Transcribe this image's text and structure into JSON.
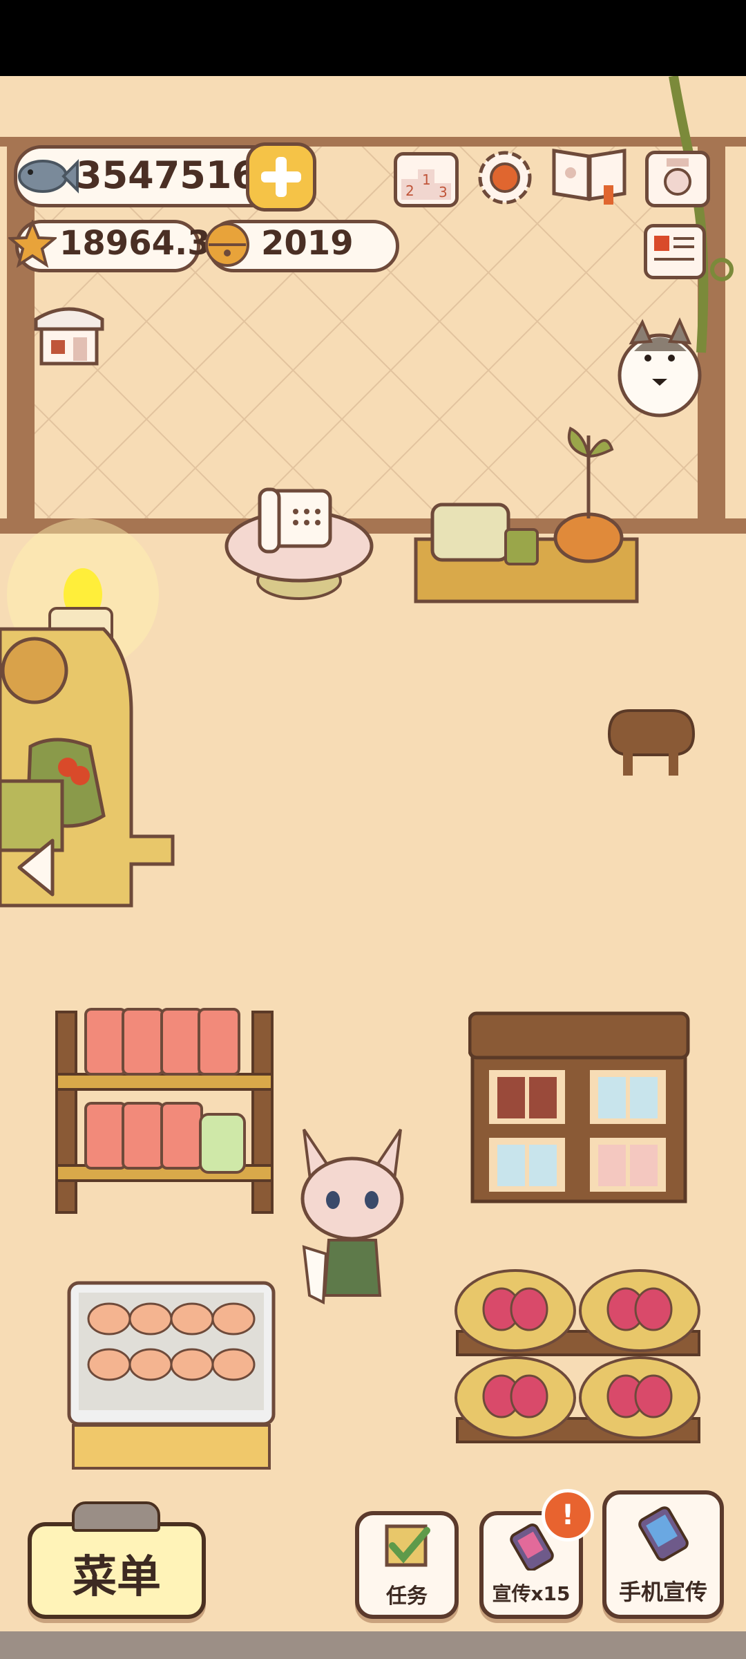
{
  "currency": {
    "fish_value": "3547516",
    "star_value": "18964.3",
    "bell_value": "2019"
  },
  "bottom_bar": {
    "menu_label": "菜单",
    "tasks_label": "任务",
    "promote_label": "宣传x15",
    "promote_badge": "!",
    "phone_promote_label": "手机宣传"
  },
  "colors": {
    "floor": "#f7dcb5",
    "wall": "#f7dcb5",
    "frame": "#9a6a4a",
    "gold_button": "#f5c347",
    "badge": "#e8632f"
  },
  "icons": [
    "fish-icon",
    "plus-icon",
    "star-icon",
    "bell-icon",
    "ranking-icon",
    "settings-gear-icon",
    "recipe-book-icon",
    "camera-icon",
    "newspaper-icon",
    "shop-icon",
    "back-arrow-icon",
    "task-check-icon",
    "promote-phone-icon"
  ]
}
